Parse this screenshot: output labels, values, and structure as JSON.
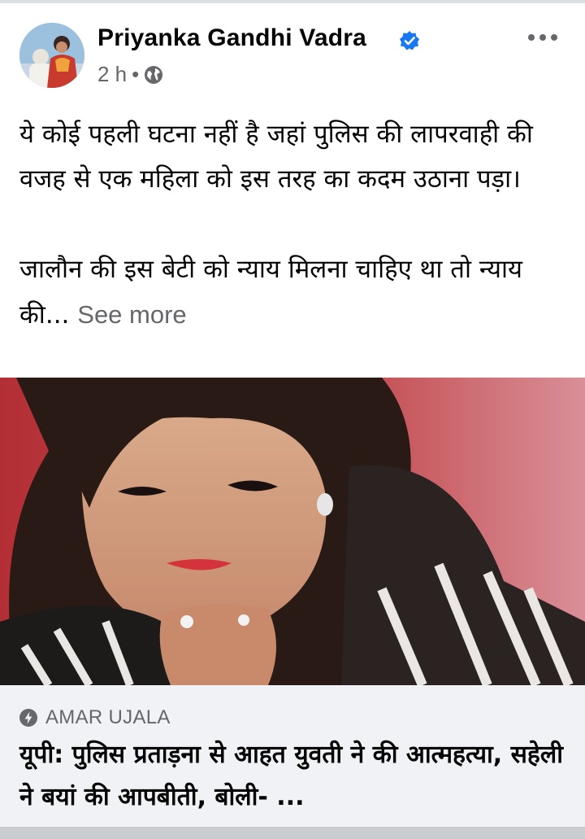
{
  "post": {
    "author": "Priyanka Gandhi Vadra",
    "time": "2 h",
    "separator": "•",
    "text_line_1": "ये कोई पहली घटना नहीं है जहां पुलिस की लापरवाही की वजह से एक महिला को इस तरह का कदम उठाना पड़ा।",
    "text_line_2": "जालौन की इस बेटी को न्याय मिलना चाहिए था तो न्याय की...",
    "see_more": "See more"
  },
  "link": {
    "source": "AMAR UJALA",
    "headline": "यूपी: पुलिस प्रताड़ना से आहत युवती ने की आत्महत्या, सहेली ने बयां की आपबीती, बोली- ..."
  },
  "icons": {
    "verified": "verified-badge-icon",
    "privacy": "globe-icon",
    "options": "more-options-icon",
    "source": "bolt-icon"
  },
  "colors": {
    "verified_blue": "#1877f2",
    "secondary_text": "#65676b",
    "link_bg": "#f0f2f5"
  }
}
